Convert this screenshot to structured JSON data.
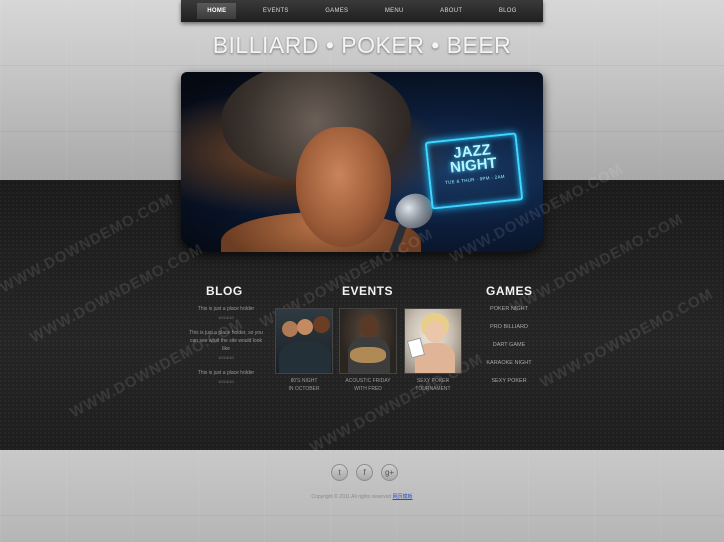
{
  "nav": {
    "items": [
      "HOME",
      "EVENTS",
      "GAMES",
      "MENU",
      "ABOUT",
      "BLOG"
    ],
    "active": "HOME"
  },
  "site_title": "BILLIARD • POKER • BEER",
  "hero": {
    "sign_title_line1": "JAZZ",
    "sign_title_line2": "NIGHT",
    "sign_subtitle": "TUE & THUR · 9PM - 2AM"
  },
  "sections": {
    "blog": {
      "title": "BLOG",
      "posts": [
        {
          "text": "This is just a place holder",
          "date": "10/14/10"
        },
        {
          "text": "This is just a place holder, so you can see what the site would look like",
          "date": "10/14/10"
        },
        {
          "text": "This is just a place holder",
          "date": "10/14/10"
        }
      ]
    },
    "events": {
      "title": "EVENTS",
      "cards": [
        {
          "caption_line1": "80'S NIGHT",
          "caption_line2": "IN OCTOBER"
        },
        {
          "caption_line1": "ACOUSTIC FRIDAY",
          "caption_line2": "WITH FRED"
        },
        {
          "caption_line1": "SEXY POKER",
          "caption_line2": "TOURNAMENT"
        }
      ]
    },
    "games": {
      "title": "GAMES",
      "items": [
        "POKER NIGHT",
        "PRO BILLIARD",
        "DART GAME",
        "KARAOKE NIGHT",
        "SEXY POKER"
      ]
    }
  },
  "footer": {
    "social": [
      "twitter-icon",
      "facebook-icon",
      "google-plus-icon"
    ],
    "social_glyphs": [
      "t",
      "f",
      "g+"
    ],
    "copyright_text": "Copyright © 2011 All rights reserved",
    "copyright_link": "网页模板"
  },
  "watermark": "WWW.DOWNDEMO.COM"
}
